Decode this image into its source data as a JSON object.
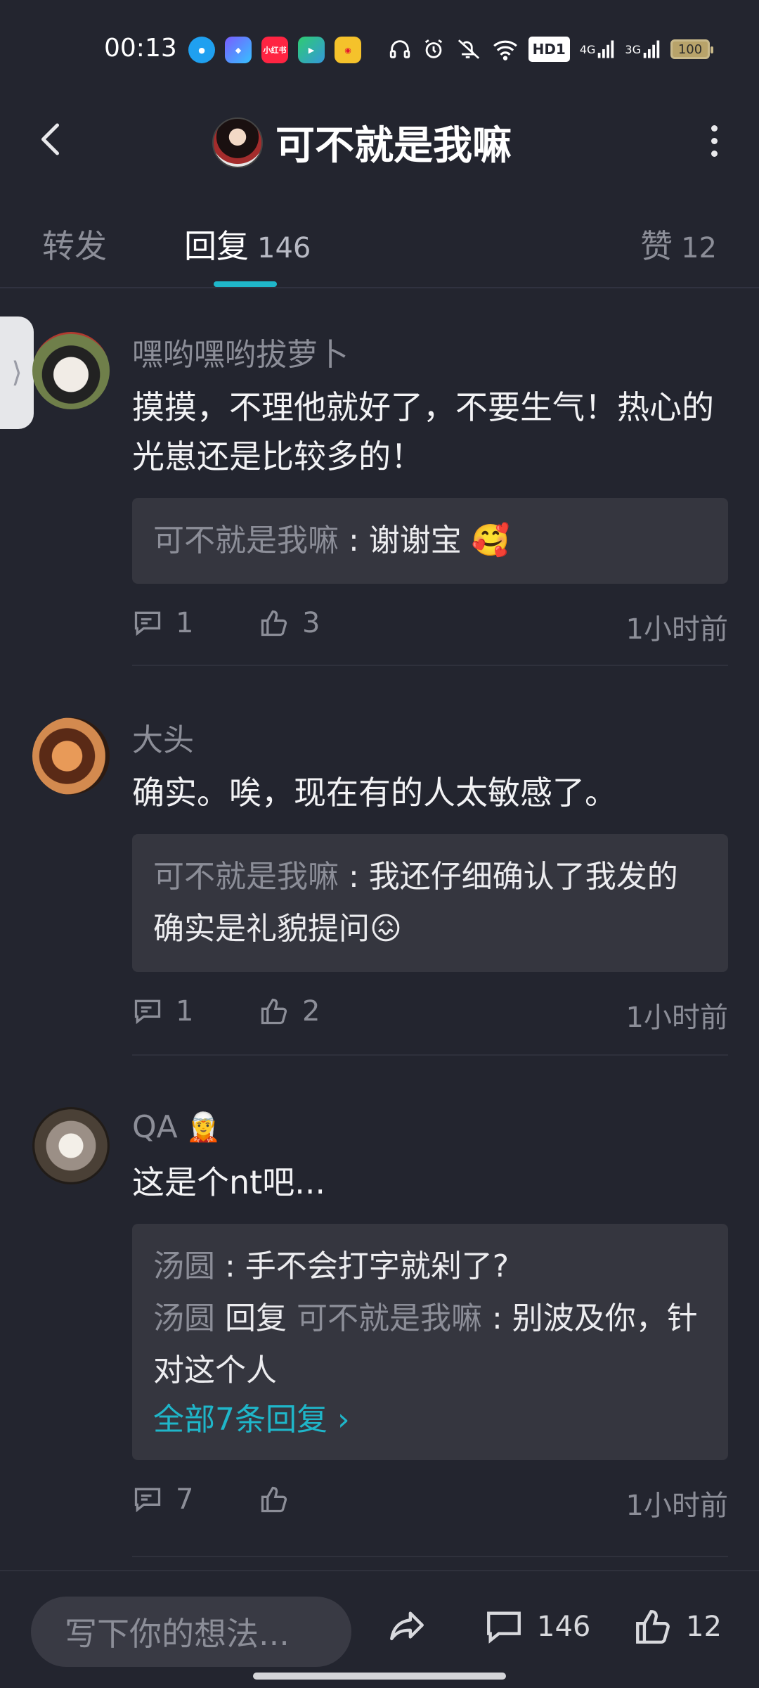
{
  "status_bar": {
    "time": "00:13",
    "app_icons": [
      "qq-icon",
      "assistant-icon",
      "xiaohongshu-icon",
      "video-icon",
      "weibo-icon"
    ],
    "xiaohongshu_label": "小红书",
    "network": [
      "4G",
      "3G"
    ],
    "hd_label": "HD1",
    "battery": "100"
  },
  "header": {
    "title": "可不就是我嘛"
  },
  "tabs": {
    "forward": {
      "label": "转发"
    },
    "reply": {
      "label": "回复",
      "count": "146"
    },
    "like": {
      "label": "赞",
      "count": "12"
    }
  },
  "comments": [
    {
      "user": "嘿哟嘿哟拔萝卜",
      "text": "摸摸，不理他就好了，不要生气！热心的光崽还是比较多的！",
      "replies": [
        {
          "name": "可不就是我嘛",
          "sep": " : ",
          "content": "谢谢宝  🥰"
        }
      ],
      "reply_count": "1",
      "like_count": "3",
      "time": "1小时前"
    },
    {
      "user": "大头",
      "text": "确实。唉，现在有的人太敏感了。",
      "replies": [
        {
          "name": "可不就是我嘛",
          "sep": " : ",
          "content": "我还仔细确认了我发的确实是礼貌提问😖"
        }
      ],
      "reply_count": "1",
      "like_count": "2",
      "time": "1小时前"
    },
    {
      "user": "QA",
      "user_emoji": "🧝",
      "text": "这是个nt吧...",
      "replies": [
        {
          "name": "汤圆",
          "sep": " : ",
          "content": "手不会打字就剁了?"
        },
        {
          "name": "汤圆",
          "verb": " 回复 ",
          "target": "可不就是我嘛",
          "sep": " : ",
          "content": "别波及你，针对这个人"
        }
      ],
      "more_replies": "全部7条回复 ›",
      "reply_count": "7",
      "like_count": "",
      "time": "1小时前"
    }
  ],
  "bottom_bar": {
    "input_placeholder": "写下你的想法...",
    "comment_count": "146",
    "like_count": "12"
  },
  "colors": {
    "background": "#23252f",
    "accent": "#1fb6c9",
    "muted_text": "#8c8e98",
    "reply_box": "#35363f"
  }
}
